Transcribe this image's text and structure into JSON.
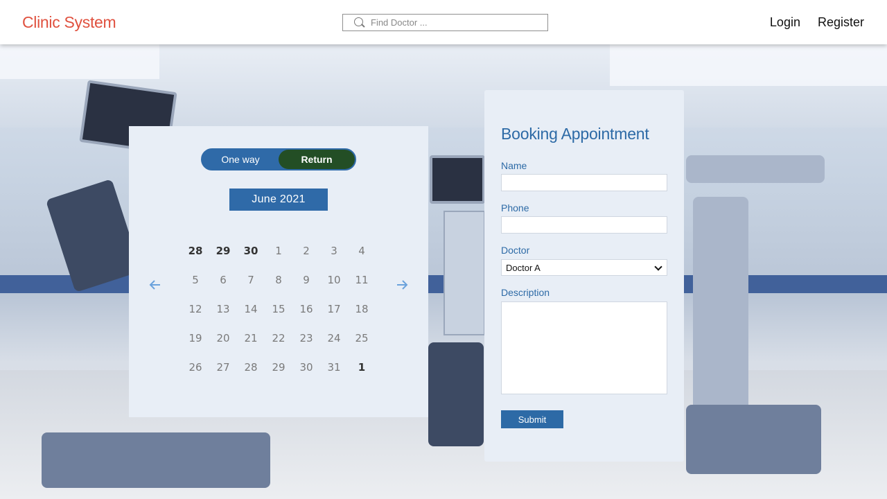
{
  "header": {
    "brand": "Clinic System",
    "search_placeholder": "Find Doctor ...",
    "nav": {
      "login": "Login",
      "register": "Register"
    }
  },
  "calendar": {
    "toggle": {
      "option_one": "One way",
      "option_two": "Return",
      "selected": "Return"
    },
    "month_label": "June 2021",
    "weekdays": [
      "",
      "",
      "",
      "",
      "",
      "",
      ""
    ],
    "weeks": [
      [
        "28",
        "29",
        "30",
        "1",
        "2",
        "3",
        "4"
      ],
      [
        "5",
        "6",
        "7",
        "8",
        "9",
        "10",
        "11"
      ],
      [
        "12",
        "13",
        "14",
        "15",
        "16",
        "17",
        "18"
      ],
      [
        "19",
        "20",
        "21",
        "22",
        "23",
        "24",
        "25"
      ],
      [
        "26",
        "27",
        "28",
        "29",
        "30",
        "31",
        "1"
      ]
    ]
  },
  "booking": {
    "title": "Booking Appointment",
    "name_label": "Name",
    "name_value": "",
    "phone_label": "Phone",
    "phone_value": "",
    "doctor_label": "Doctor",
    "doctor_selected": "Doctor A",
    "description_label": "Description",
    "description_value": "",
    "submit_label": "Submit"
  },
  "colors": {
    "brand": "#e0513f",
    "primary": "#2f6aa8",
    "toggle_active": "#234e25",
    "card_bg": "#e8eef6"
  }
}
